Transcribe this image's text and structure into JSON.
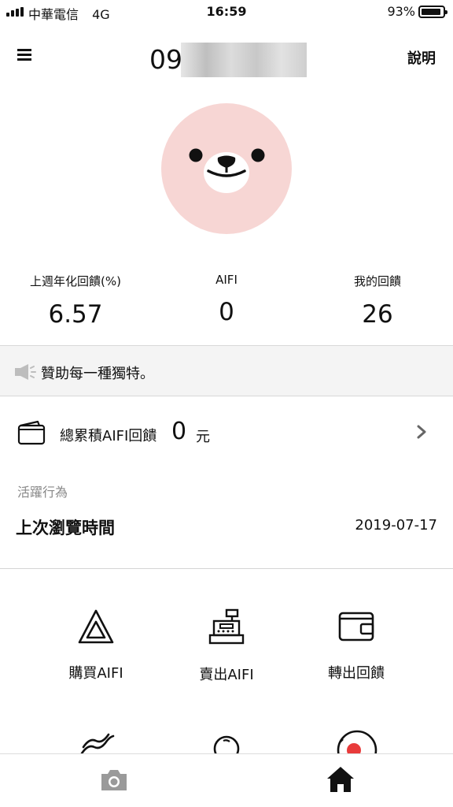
{
  "status_bar": {
    "carrier": "中華電信",
    "network": "4G",
    "time": "16:59",
    "battery": "93%"
  },
  "header": {
    "account_prefix": "09",
    "help_label": "說明"
  },
  "stats": [
    {
      "label": "上週年化回饋(%)",
      "value": "6.57"
    },
    {
      "label": "AIFI",
      "value": "0"
    },
    {
      "label": "我的回饋",
      "value": "26"
    }
  ],
  "announcement": {
    "text": "贊助每一種獨特。"
  },
  "total": {
    "label": "總累積AIFI回饋",
    "value": "0",
    "unit": "元"
  },
  "activity": {
    "section_label": "活躍行為",
    "last_browse_label": "上次瀏覽時間",
    "last_browse_value": "2019-07-17"
  },
  "actions": [
    {
      "label": "購買AIFI",
      "icon": "aifi-triangle-icon"
    },
    {
      "label": "賣出AIFI",
      "icon": "cash-register-icon"
    },
    {
      "label": "轉出回饋",
      "icon": "wallet-icon"
    }
  ],
  "bottom_nav": [
    {
      "icon": "camera-icon",
      "active": false
    },
    {
      "icon": "home-icon",
      "active": true
    }
  ],
  "colors": {
    "avatar_bg": "#f7d6d4",
    "announce_bg": "#f4f4f4",
    "muted_text": "#888888",
    "inactive_icon": "#9a9a9a"
  }
}
